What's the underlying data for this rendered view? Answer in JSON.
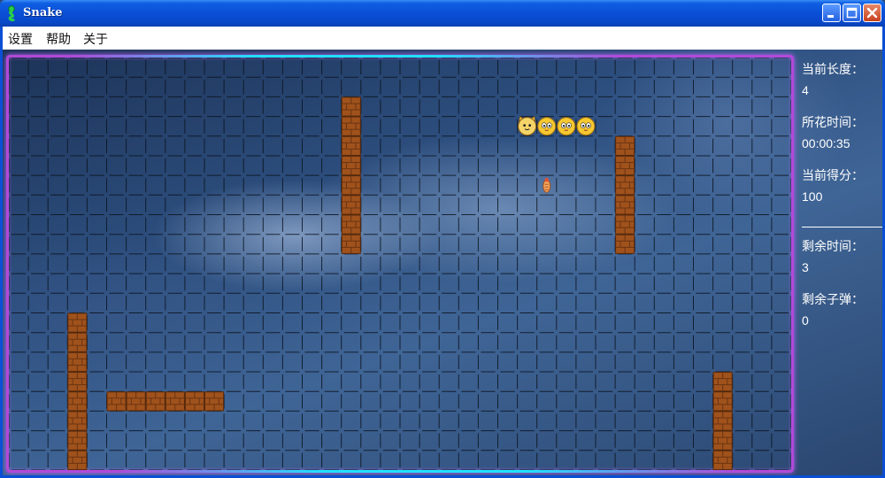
{
  "window": {
    "title": "Snake",
    "app_icon": "snake-icon",
    "controls": [
      "minimize-icon",
      "maximize-icon",
      "close-icon"
    ],
    "title_bar_color": "#0a4fd6"
  },
  "menu": {
    "settings_label": "设置",
    "help_label": "帮助",
    "about_label": "关于"
  },
  "stats": {
    "length_label": "当前长度：",
    "length_value": "4",
    "elapsed_label": "所花时间：",
    "elapsed_value": "00:00:35",
    "score_label": "当前得分：",
    "score_value": "100",
    "remaining_time_label": "剩余时间：",
    "remaining_time_value": "3",
    "remaining_bullets_label": "剩余子弹：",
    "remaining_bullets_value": "0"
  },
  "board": {
    "columns": 40,
    "rows": 21,
    "border_color": "#b04ad8",
    "glow_color": "#22e0ff",
    "wall_color": "#a0521c",
    "walls": [
      {
        "col": 17,
        "row": 2
      },
      {
        "col": 17,
        "row": 3
      },
      {
        "col": 17,
        "row": 4
      },
      {
        "col": 17,
        "row": 5
      },
      {
        "col": 17,
        "row": 6
      },
      {
        "col": 17,
        "row": 7
      },
      {
        "col": 17,
        "row": 8
      },
      {
        "col": 17,
        "row": 9
      },
      {
        "col": 31,
        "row": 4
      },
      {
        "col": 31,
        "row": 5
      },
      {
        "col": 31,
        "row": 6
      },
      {
        "col": 31,
        "row": 7
      },
      {
        "col": 31,
        "row": 8
      },
      {
        "col": 31,
        "row": 9
      },
      {
        "col": 3,
        "row": 13
      },
      {
        "col": 3,
        "row": 14
      },
      {
        "col": 3,
        "row": 15
      },
      {
        "col": 3,
        "row": 16
      },
      {
        "col": 3,
        "row": 17
      },
      {
        "col": 3,
        "row": 18
      },
      {
        "col": 3,
        "row": 19
      },
      {
        "col": 3,
        "row": 20
      },
      {
        "col": 5,
        "row": 17
      },
      {
        "col": 6,
        "row": 17
      },
      {
        "col": 7,
        "row": 17
      },
      {
        "col": 8,
        "row": 17
      },
      {
        "col": 9,
        "row": 17
      },
      {
        "col": 10,
        "row": 17
      },
      {
        "col": 36,
        "row": 16
      },
      {
        "col": 36,
        "row": 17
      },
      {
        "col": 36,
        "row": 18
      },
      {
        "col": 36,
        "row": 19
      },
      {
        "col": 36,
        "row": 20
      }
    ],
    "snake": [
      {
        "col": 26,
        "row": 3,
        "part": "head"
      },
      {
        "col": 27,
        "row": 3,
        "part": "body"
      },
      {
        "col": 28,
        "row": 3,
        "part": "body"
      },
      {
        "col": 29,
        "row": 3,
        "part": "body"
      }
    ],
    "food": {
      "col": 27,
      "row": 6,
      "icon": "food-icon"
    }
  }
}
